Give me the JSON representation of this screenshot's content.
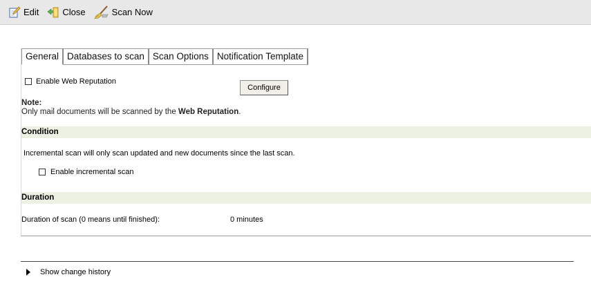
{
  "toolbar": {
    "edit_label": "Edit",
    "close_label": "Close",
    "scan_now_label": "Scan Now"
  },
  "tabs": [
    {
      "label": "General",
      "active": true
    },
    {
      "label": "Databases to scan",
      "active": false
    },
    {
      "label": "Scan Options",
      "active": false
    },
    {
      "label": "Notification Template",
      "active": false
    }
  ],
  "general": {
    "web_reputation": {
      "label": "Enable Web Reputation",
      "checked": false
    },
    "configure_label": "Configure",
    "note_title": "Note:",
    "note_text_prefix": "Only mail documents will be scanned by the ",
    "note_text_bold": "Web Reputation",
    "note_text_suffix": "."
  },
  "condition": {
    "header": "Condition",
    "description": "Incremental scan will only scan updated and new documents since the last scan.",
    "incremental": {
      "label": "Enable incremental scan",
      "checked": false
    }
  },
  "duration": {
    "header": "Duration",
    "label": "Duration of scan (0 means until finished):",
    "value": "0 minutes"
  },
  "history": {
    "label": "Show change history"
  },
  "colors": {
    "toolbar_bg": "#e8e8e8",
    "section_header_bg": "#edf1e4"
  }
}
